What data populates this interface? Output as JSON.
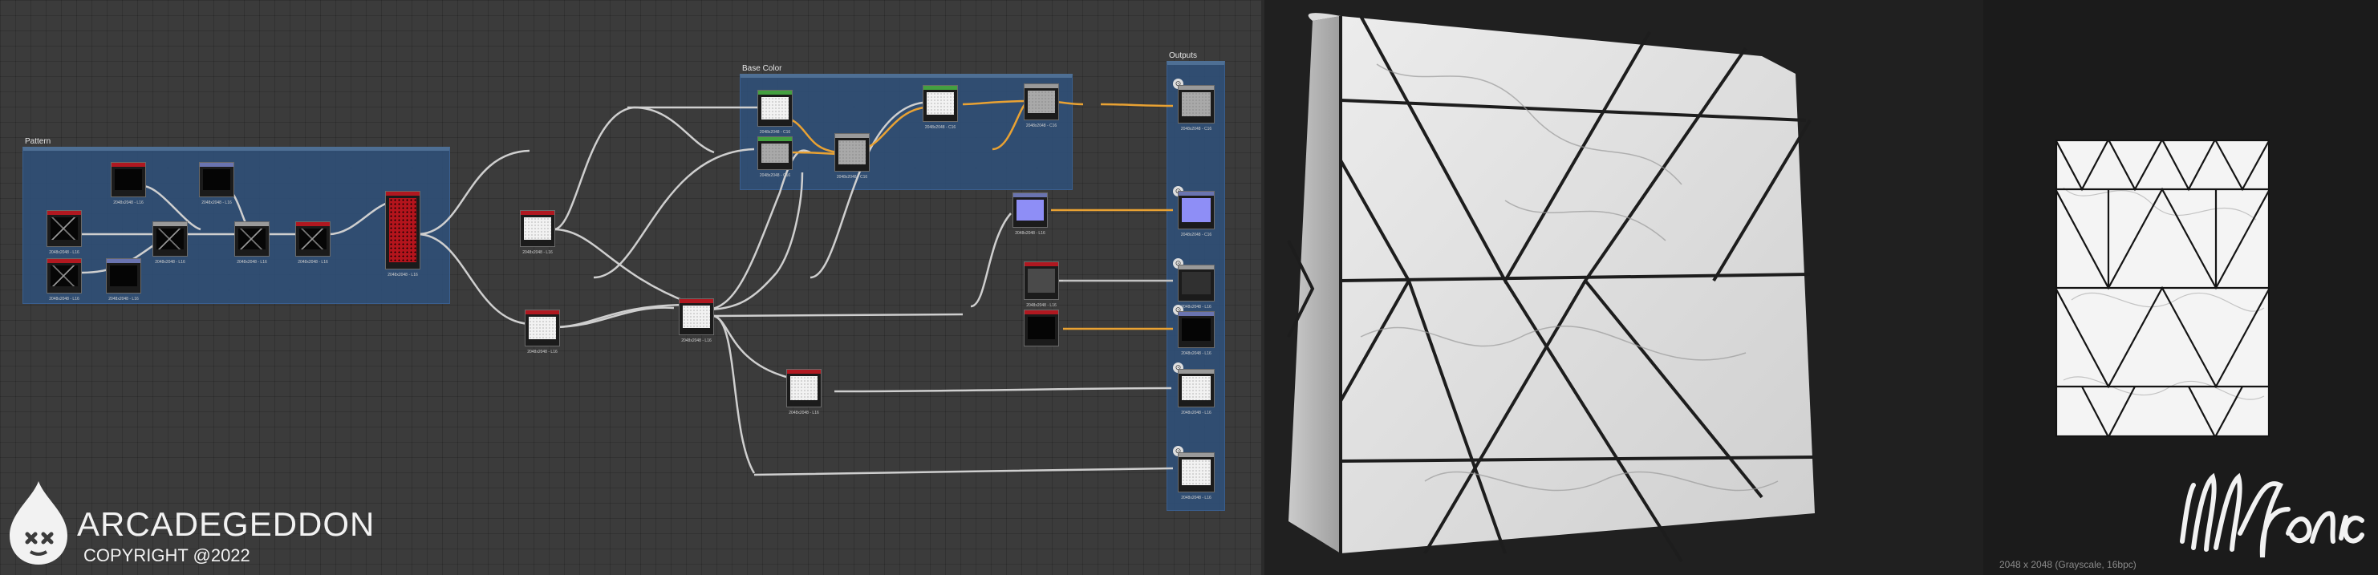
{
  "graph": {
    "frames": {
      "pattern": "Pattern",
      "base_color": "Base Color",
      "outputs": "Outputs"
    },
    "node_labels": {
      "n1": "2048x2048 - L16",
      "n2": "2048x2048 - L16",
      "n3": "2048x2048 - L16",
      "n4": "2048x2048 - L16",
      "n5": "2048x2048 - L16",
      "n6": "2048x2048 - L16",
      "n7": "2048x2048 - L16",
      "n8": "2048x2048 - L16",
      "n9": "2048x2048 - L16",
      "n10": "2048x2048 - L16",
      "n11": "2048x2048 - L16",
      "n12": "2048x2048 - L16",
      "n13": "2048x2048 - L16",
      "n14": "2048x2048 - C16",
      "n15": "2048x2048 - C16",
      "n16": "2048x2048 - C16",
      "n17": "2048x2048 - C16",
      "n18": "2048x2048 - C16",
      "n19": "2048x2048 - L16",
      "n20": "2048x2048 - L16",
      "o1": "2048x2048 - C16",
      "o2": "2048x2048 - C16",
      "o3": "2048x2048 - L16",
      "o4": "2048x2048 - L16",
      "o5": "2048x2048 - L16",
      "o6": "2048x2048 - L16"
    },
    "connection_colors": {
      "grayscale": "#cfcfcf",
      "color": "#e9a233"
    }
  },
  "branding": {
    "company": "ARCADEGEDDON",
    "copyright": "COPYRIGHT @2022",
    "partner_logo_text": "illfonic"
  },
  "view2d": {
    "info": "2048 x 2048 (Grayscale, 16bpc)"
  },
  "icons": [
    "output-icon",
    "arcadegeddon-logo-icon",
    "illfonic-logo"
  ]
}
